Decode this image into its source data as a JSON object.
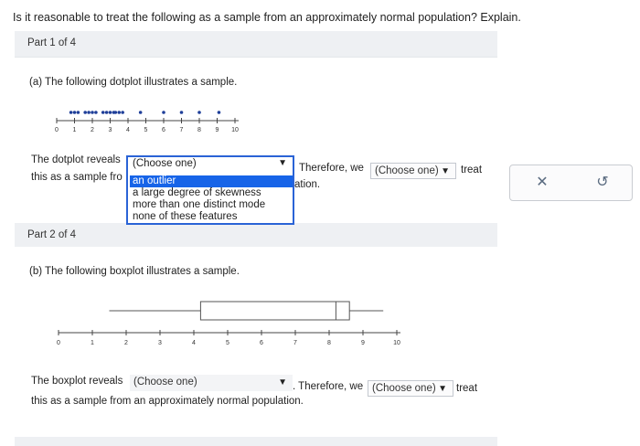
{
  "question": "Is it reasonable to treat the following as a sample from an approximately normal population? Explain.",
  "part1": {
    "header": "Part 1 of 4",
    "prompt": "(a) The following dotplot illustrates a sample.",
    "dotplot": {
      "ticks": [
        "0",
        "1",
        "2",
        "3",
        "4",
        "5",
        "6",
        "7",
        "8",
        "9",
        "10"
      ],
      "points": [
        {
          "x": 0.8,
          "y": 1
        },
        {
          "x": 1.0,
          "y": 1
        },
        {
          "x": 1.2,
          "y": 1
        },
        {
          "x": 1.6,
          "y": 1
        },
        {
          "x": 1.8,
          "y": 1
        },
        {
          "x": 2.0,
          "y": 1
        },
        {
          "x": 2.2,
          "y": 1
        },
        {
          "x": 2.6,
          "y": 1
        },
        {
          "x": 2.8,
          "y": 1
        },
        {
          "x": 3.0,
          "y": 1
        },
        {
          "x": 3.2,
          "y": 1
        },
        {
          "x": 3.3,
          "y": 1
        },
        {
          "x": 3.5,
          "y": 1
        },
        {
          "x": 3.7,
          "y": 1
        },
        {
          "x": 4.7,
          "y": 1
        },
        {
          "x": 6.0,
          "y": 1
        },
        {
          "x": 7.0,
          "y": 1
        },
        {
          "x": 8.0,
          "y": 1
        },
        {
          "x": 9.1,
          "y": 1
        }
      ]
    },
    "sentence_start": "The dotplot reveals",
    "sentence_line2": "this as a sample fro",
    "therefore": "Therefore, we",
    "treat": "treat",
    "ation": "ation.",
    "dropdown": {
      "current": "(Choose one)",
      "options": [
        "an outlier",
        "a large degree of skewness",
        "more than one distinct mode",
        "none of these features"
      ],
      "highlighted_index": 0
    },
    "select2": "(Choose one)"
  },
  "part2": {
    "header": "Part 2 of 4",
    "prompt": "(b) The following boxplot illustrates a sample.",
    "boxplot": {
      "ticks": [
        "0",
        "1",
        "2",
        "3",
        "4",
        "5",
        "6",
        "7",
        "8",
        "9",
        "10"
      ],
      "min": 1.5,
      "q1": 4.2,
      "median": 8.2,
      "q3": 8.6,
      "max": 9.6
    },
    "sentence": "The boxplot reveals",
    "select1": "(Choose one)",
    "therefore": ". Therefore, we",
    "select2": "(Choose one)",
    "treat": "treat",
    "line2": "this as a sample from an approximately normal population."
  },
  "actions": {
    "close_glyph": "✕",
    "undo_glyph": "↺"
  }
}
